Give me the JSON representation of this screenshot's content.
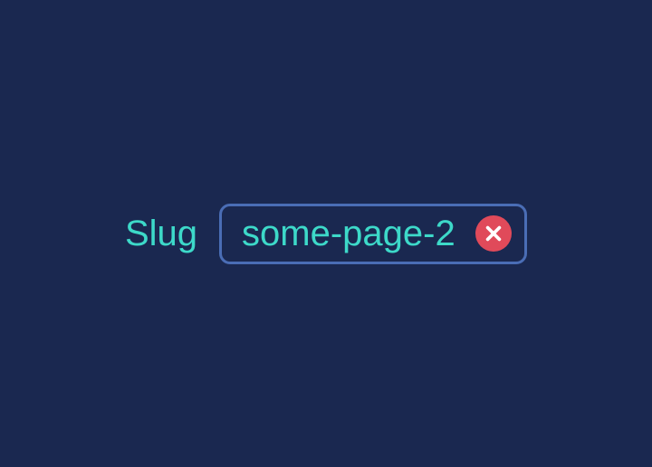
{
  "form": {
    "slug": {
      "label": "Slug",
      "value": "some-page-2",
      "status": "error"
    }
  },
  "colors": {
    "background": "#1a2850",
    "accent": "#3dd9c9",
    "border": "#4a6db5",
    "error": "#e04a5a"
  }
}
